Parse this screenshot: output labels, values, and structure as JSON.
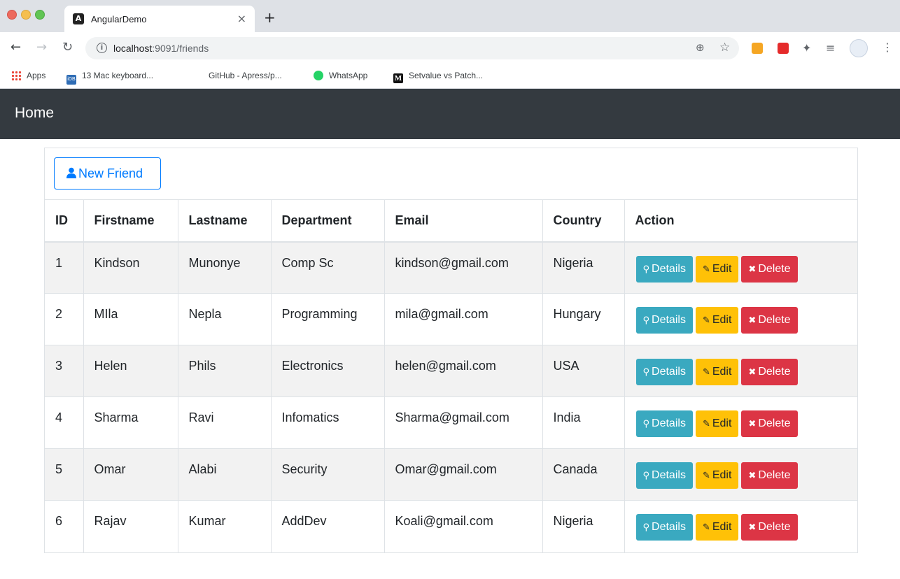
{
  "browser": {
    "tab_title": "AngularDemo",
    "tab_close": "×",
    "new_tab": "+",
    "url_host": "localhost",
    "url_path": ":9091/friends",
    "bookmarks": [
      {
        "label": "Apps",
        "icon": "apps-grid-icon"
      },
      {
        "label": "13 Mac keyboard...",
        "icon": "idb-icon"
      },
      {
        "label": "GitHub - Apress/p...",
        "icon": "none"
      },
      {
        "label": "WhatsApp",
        "icon": "whatsapp-icon"
      },
      {
        "label": "Setvalue vs Patch...",
        "icon": "medium-icon"
      }
    ]
  },
  "navbar": {
    "brand": "Home"
  },
  "toolbar": {
    "new_friend_label": "New Friend"
  },
  "table": {
    "headers": [
      "ID",
      "Firstname",
      "Lastname",
      "Department",
      "Email",
      "Country",
      "Action"
    ],
    "rows": [
      {
        "id": "1",
        "firstname": "Kindson",
        "lastname": "Munonye",
        "department": "Comp Sc",
        "email": "kindson@gmail.com",
        "country": "Nigeria"
      },
      {
        "id": "2",
        "firstname": "MIla",
        "lastname": "Nepla",
        "department": "Programming",
        "email": "mila@gmail.com",
        "country": "Hungary"
      },
      {
        "id": "3",
        "firstname": "Helen",
        "lastname": "Phils",
        "department": "Electronics",
        "email": "helen@gmail.com",
        "country": "USA"
      },
      {
        "id": "4",
        "firstname": "Sharma",
        "lastname": "Ravi",
        "department": "Infomatics",
        "email": "Sharma@gmail.com",
        "country": "India"
      },
      {
        "id": "5",
        "firstname": "Omar",
        "lastname": "Alabi",
        "department": "Security",
        "email": "Omar@gmail.com",
        "country": "Canada"
      },
      {
        "id": "6",
        "firstname": "Rajav",
        "lastname": "Kumar",
        "department": "AddDev",
        "email": "Koali@gmail.com",
        "country": "Nigeria"
      }
    ],
    "actions": {
      "details": "Details",
      "edit": "Edit",
      "delete": "Delete"
    }
  },
  "colors": {
    "navbar_bg": "#343a40",
    "primary": "#007bff",
    "info": "#3aa9c0",
    "warning": "#ffc107",
    "danger": "#dc3545"
  }
}
